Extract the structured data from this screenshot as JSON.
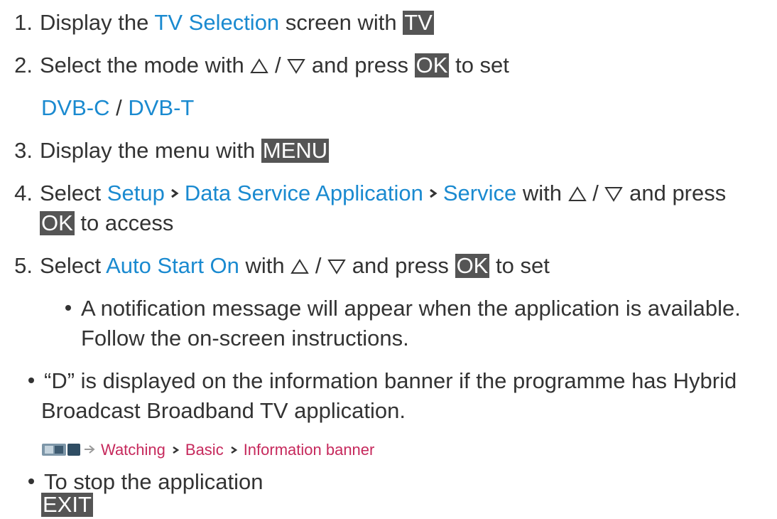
{
  "steps": [
    {
      "num": "1.",
      "prefix": "Display the",
      "link": "TV Selection",
      "middle": "screen with",
      "key": "TV"
    },
    {
      "num": "2.",
      "prefix": "Select the mode with",
      "sep": "/",
      "suffix": "and press",
      "key": "OK",
      "end": "to set",
      "options": [
        "DVB-C",
        "/",
        "DVB-T"
      ]
    },
    {
      "num": "3.",
      "prefix": "Display the menu with",
      "key": "MENU"
    },
    {
      "num": "4.",
      "prefix": "Select",
      "path": [
        "Setup",
        "Data Service Application",
        "Service"
      ],
      "mid": "with",
      "sep": "/",
      "suffix": "and press",
      "key": "OK",
      "end": "to access"
    },
    {
      "num": "5.",
      "prefix": "Select",
      "link": "Auto Start On",
      "mid": "with",
      "sep": "/",
      "suffix": "and press",
      "key": "OK",
      "end": "to set"
    }
  ],
  "step5_note_lines": [
    "A notification message will appear when the application is available.",
    "Follow the on-screen instructions."
  ],
  "note1_lines": [
    "“D” is displayed on the information banner if the programme has Hybrid",
    "Broadcast Broadband TV application."
  ],
  "ref_path": [
    "Watching",
    "Basic",
    "Information banner"
  ],
  "note2": "To stop the application",
  "exit_key": "EXIT",
  "colors": {
    "link": "#1a8ad0",
    "ref_link": "#c6295c",
    "key_bg": "#555555",
    "text": "#333333"
  }
}
